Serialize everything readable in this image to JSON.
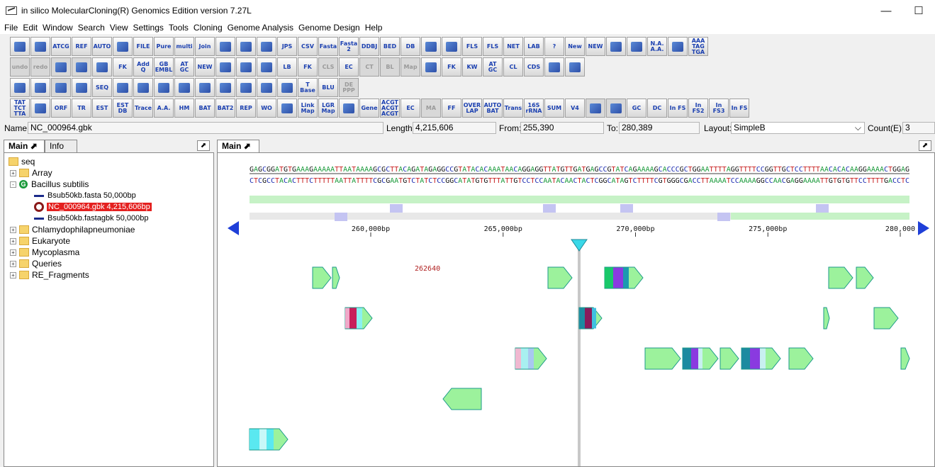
{
  "window": {
    "title": "in silico MolecularCloning(R) Genomics Edition version 7.27L",
    "minimize_glyph": "—",
    "maximize_glyph": "☐"
  },
  "menu": [
    "File",
    "Edit",
    "Window",
    "Search",
    "View",
    "Settings",
    "Tools",
    "Cloning",
    "Genome Analysis",
    "Genome Design",
    "Help"
  ],
  "toolbar": {
    "row1": [
      "",
      "",
      "ATCG",
      "REF",
      "AUTO",
      "",
      "FILE",
      "Pure",
      "multi",
      "Join",
      "",
      "",
      "",
      "JPS",
      "CSV",
      "Fasta",
      "Fasta 2",
      "DDBJ",
      "BED",
      "DB",
      "",
      "",
      "FLS",
      "FLS",
      "NET",
      "LAB",
      "?",
      "New",
      "NEW",
      "",
      "",
      "N.A. A.A.",
      "",
      "AAA TAG TGA"
    ],
    "row2": [
      "undo",
      "redo",
      "",
      "",
      "",
      "FK",
      "Add Q",
      "GB EMBL",
      "AT GC",
      "NEW",
      "",
      "",
      "",
      "LB",
      "FK",
      "CLS",
      "EC",
      "CT",
      "BL",
      "Map",
      "",
      "FK",
      "KW",
      "AT GC",
      "CL",
      "CDS",
      "",
      ""
    ],
    "row3": [
      "",
      "",
      "",
      "",
      "SEQ",
      "",
      "",
      "",
      "",
      "",
      "",
      "",
      "",
      "",
      "T Base",
      "BLU",
      "DE PPP"
    ],
    "row4": [
      "TAT TCT TTA",
      "",
      "ORF",
      "TR",
      "EST",
      "EST DB",
      "Trace",
      "A.A.",
      "HM",
      "BAT",
      "BAT2",
      "REP",
      "WO",
      "",
      "Link Map",
      "LGR Map",
      "",
      "Gene",
      "ACGT ACGT ACGT",
      "EC",
      "MA",
      "FF",
      "OVER LAP",
      "AUTO BAT",
      "Trans",
      "16S rRNA",
      "SUM",
      "V4",
      "",
      "",
      "GC",
      "DC",
      "In FS",
      "In FS2",
      "In FS3",
      "In FS"
    ]
  },
  "infobar": {
    "name_label": "Name:",
    "name_value": "NC_000964.gbk",
    "length_label": "Length:",
    "length_value": "4,215,606",
    "from_label": "From:",
    "from_value": "255,390",
    "to_label": "To:",
    "to_value": "280,389",
    "layout_label": "Layout:",
    "layout_value": "SimpleB",
    "count_label": "Count(E):",
    "count_value": "3"
  },
  "left_tabs": {
    "main": "Main",
    "info": "Info"
  },
  "right_tabs": {
    "main": "Main"
  },
  "tree": [
    {
      "label": "seq",
      "kind": "folder",
      "level": 0
    },
    {
      "label": "Array",
      "kind": "folder",
      "level": 1,
      "expander": "+"
    },
    {
      "label": "Bacillus subtilis",
      "kind": "genome",
      "level": 1,
      "expander": "-"
    },
    {
      "label": "Bsub50kb.fasta  50,000bp",
      "kind": "seq",
      "level": 2
    },
    {
      "label": "NC_000964.gbk  4,215,606bp",
      "kind": "circular",
      "level": 2,
      "selected": true
    },
    {
      "label": "Bsub50kb.fastagbk  50,000bp",
      "kind": "seq",
      "level": 2
    },
    {
      "label": "Chlamydophilapneumoniae",
      "kind": "folder",
      "level": 1,
      "expander": "+"
    },
    {
      "label": "Eukaryote",
      "kind": "folder",
      "level": 1,
      "expander": "+"
    },
    {
      "label": "Mycoplasma",
      "kind": "folder",
      "level": 1,
      "expander": "+"
    },
    {
      "label": "Queries",
      "kind": "folder",
      "level": 1,
      "expander": "+"
    },
    {
      "label": "RE_Fragments",
      "kind": "folder",
      "level": 1,
      "expander": "+"
    }
  ],
  "sequence": {
    "top": "GAGCGGATGTGAAAGAAAAATTAATAAAAGCGCTTACAGATAGAGGCCGTATACACAAATAACAGGAGGTTATGTTGATGAGCCGTATCAGAAAAGCACCCGCTGGAATTTTAGGTTTTCCGGTTGCTCCTTTTAACACACAAGGAAAACTGGAG",
    "bottom": "CTCGCCTACACTTTCTTTTTAATTATTTTCGCGAATGTCTATCTCCGGCATATGTGTTTATTGTCCTCCAATACAACTACTCGGCATAGTCTTTTCGTGGGCGACCTTAAAATCCAAAAGGCCAACGAGGAAAATTGTGTGTTCCTTTTGACCTC"
  },
  "ruler": {
    "ticks": [
      {
        "label": "260,000bp",
        "bp": 260000
      },
      {
        "label": "265,000bp",
        "bp": 265000
      },
      {
        "label": "270,000bp",
        "bp": 270000
      },
      {
        "label": "275,000bp",
        "bp": 275000
      },
      {
        "label": "280,000",
        "bp": 280000
      }
    ]
  },
  "cursor_label": "262640",
  "colors": {
    "gene_fill": "#9cf29c",
    "gene_stroke": "#1c9a8a",
    "selected_bg": "#e4201f",
    "nav_arrow": "#1f3fd8",
    "cursor": "#3ad8e8"
  }
}
